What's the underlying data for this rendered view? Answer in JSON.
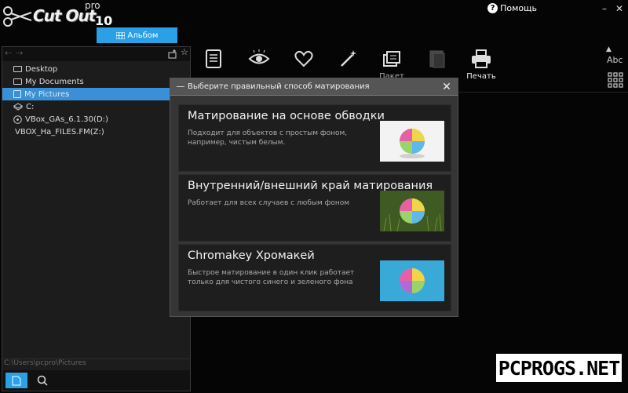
{
  "app": {
    "name": "Cut Out",
    "edition": "pro",
    "version": "10"
  },
  "header": {
    "album_label": "Альбом",
    "help_label": "Помощь",
    "help_glyph": "?",
    "minimize_glyph": "–",
    "close_glyph": "✕"
  },
  "tree": {
    "items": [
      {
        "label": "Desktop",
        "icon": "folder-icon"
      },
      {
        "label": "My Documents",
        "icon": "folder-icon"
      },
      {
        "label": "My Pictures",
        "icon": "pictures-icon",
        "selected": true
      },
      {
        "label": "C:",
        "icon": "drive-icon"
      },
      {
        "label": "VBox_GAs_6.1.30(D:)",
        "icon": "cd-icon"
      },
      {
        "label": "VBOX_Ha_FILES.FM(Z:)",
        "icon": "none"
      }
    ],
    "current_path": "C:\\Users\\pcpro\\Pictures"
  },
  "toolbar": {
    "tools": [
      {
        "id": "list",
        "label": ""
      },
      {
        "id": "view",
        "label": ""
      },
      {
        "id": "favorite",
        "label": ""
      },
      {
        "id": "retouch",
        "label": ""
      },
      {
        "id": "batch",
        "label": "Пакет"
      },
      {
        "id": "layers",
        "label": ""
      },
      {
        "id": "print",
        "label": "Печать"
      }
    ],
    "sort_label": "Abc"
  },
  "modal": {
    "title": "Выберите правильный способ матирования",
    "close_glyph": "✕",
    "options": [
      {
        "title": "Матирование на основе обводки",
        "description": "Подходит для объектов с простым фоном, например, чистым белым.",
        "background": "#f3f3f3"
      },
      {
        "title": "Внутренний/внешний край матирования",
        "description": "Работает для всех случаев с любым фоном",
        "background": "#3f5a22"
      },
      {
        "title": "Chromakey Хромакей",
        "description": "Быстрое матирование в один клик работает только для чистого синего и зеленого фона",
        "background": "#39a9d8"
      }
    ]
  },
  "watermark": "PCPROGS.NET",
  "colors": {
    "accent": "#2aa0e6",
    "selection": "#3b8fd6",
    "background": "#050505"
  }
}
